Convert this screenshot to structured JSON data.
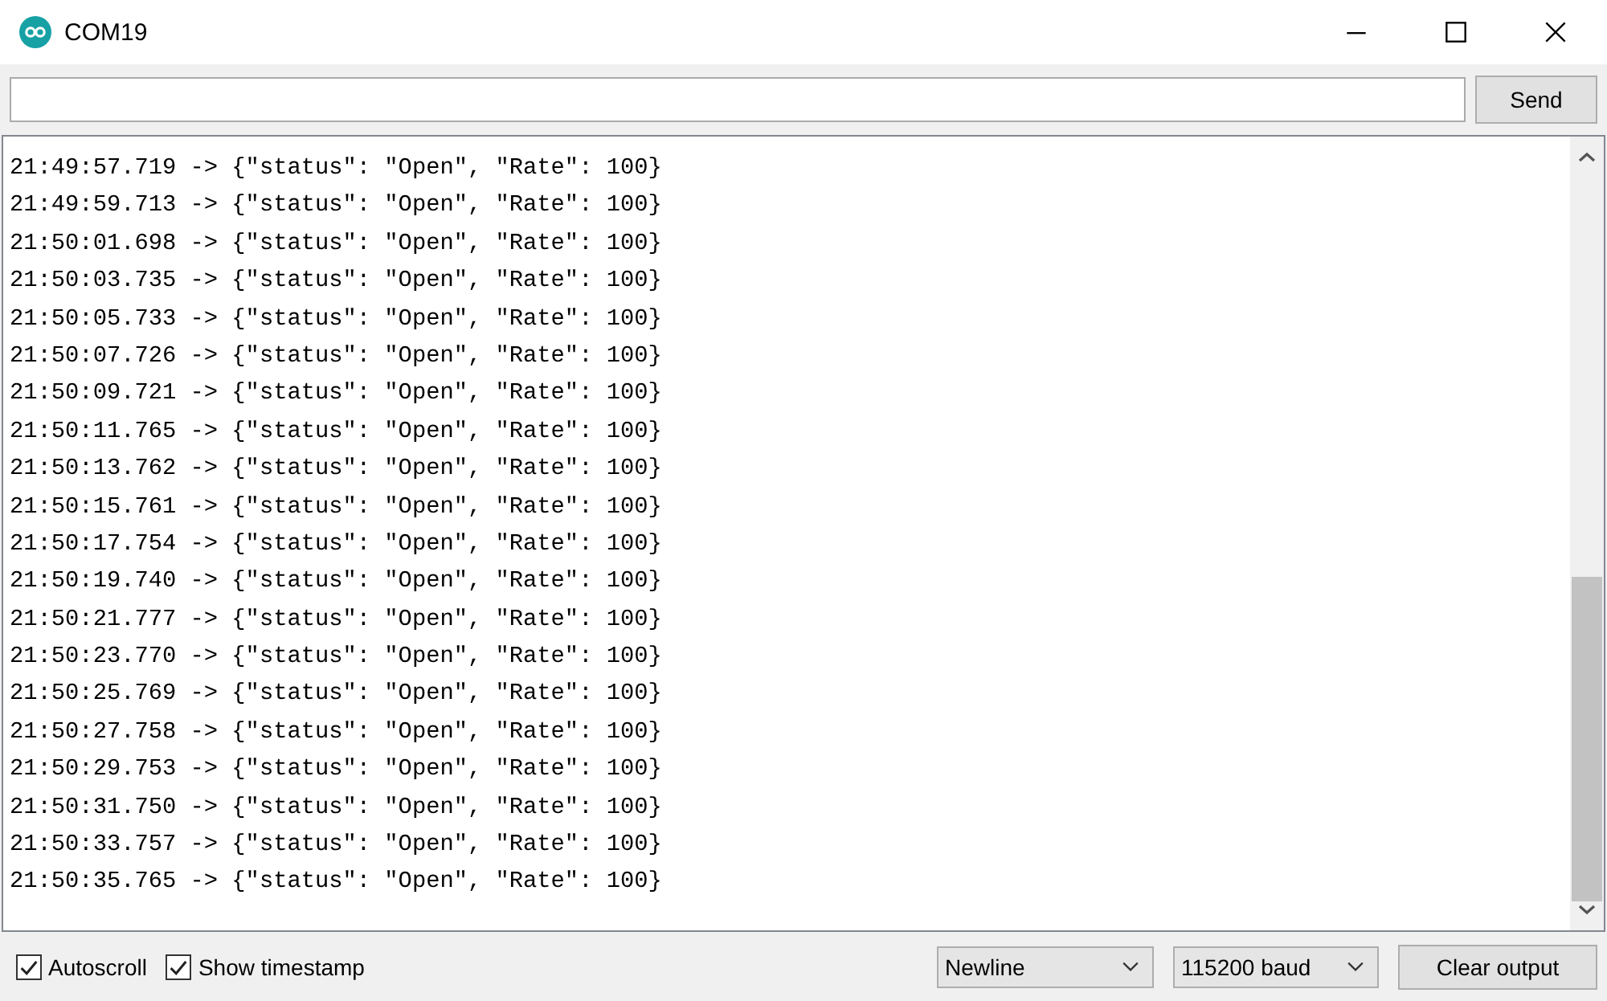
{
  "window": {
    "title": "COM19"
  },
  "send_button": "Send",
  "lines": [
    {
      "time": "21:49:57.719",
      "text": "-> {\"status\": \"Open\", \"Rate\": 100}"
    },
    {
      "time": "21:49:59.713",
      "text": "-> {\"status\": \"Open\", \"Rate\": 100}"
    },
    {
      "time": "21:50:01.698",
      "text": "-> {\"status\": \"Open\", \"Rate\": 100}"
    },
    {
      "time": "21:50:03.735",
      "text": "-> {\"status\": \"Open\", \"Rate\": 100}"
    },
    {
      "time": "21:50:05.733",
      "text": "-> {\"status\": \"Open\", \"Rate\": 100}"
    },
    {
      "time": "21:50:07.726",
      "text": "-> {\"status\": \"Open\", \"Rate\": 100}"
    },
    {
      "time": "21:50:09.721",
      "text": "-> {\"status\": \"Open\", \"Rate\": 100}"
    },
    {
      "time": "21:50:11.765",
      "text": "-> {\"status\": \"Open\", \"Rate\": 100}"
    },
    {
      "time": "21:50:13.762",
      "text": "-> {\"status\": \"Open\", \"Rate\": 100}"
    },
    {
      "time": "21:50:15.761",
      "text": "-> {\"status\": \"Open\", \"Rate\": 100}"
    },
    {
      "time": "21:50:17.754",
      "text": "-> {\"status\": \"Open\", \"Rate\": 100}"
    },
    {
      "time": "21:50:19.740",
      "text": "-> {\"status\": \"Open\", \"Rate\": 100}"
    },
    {
      "time": "21:50:21.777",
      "text": "-> {\"status\": \"Open\", \"Rate\": 100}"
    },
    {
      "time": "21:50:23.770",
      "text": "-> {\"status\": \"Open\", \"Rate\": 100}"
    },
    {
      "time": "21:50:25.769",
      "text": "-> {\"status\": \"Open\", \"Rate\": 100}"
    },
    {
      "time": "21:50:27.758",
      "text": "-> {\"status\": \"Open\", \"Rate\": 100}"
    },
    {
      "time": "21:50:29.753",
      "text": "-> {\"status\": \"Open\", \"Rate\": 100}"
    },
    {
      "time": "21:50:31.750",
      "text": "-> {\"status\": \"Open\", \"Rate\": 100}"
    },
    {
      "time": "21:50:33.757",
      "text": "-> {\"status\": \"Open\", \"Rate\": 100}"
    },
    {
      "time": "21:50:35.765",
      "text": "-> {\"status\": \"Open\", \"Rate\": 100}"
    }
  ],
  "options": [
    {
      "label": "Autoscroll",
      "checked": true
    },
    {
      "label": "Show timestamp",
      "checked": true
    }
  ],
  "line_ending": "Newline",
  "baud_rate": "115200 baud",
  "clear_button": "Clear output"
}
